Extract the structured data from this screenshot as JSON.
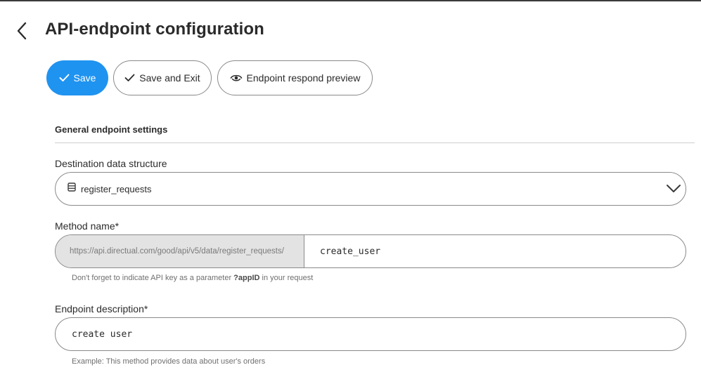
{
  "header": {
    "title": "API-endpoint configuration",
    "back_icon": "chevron-left-icon"
  },
  "toolbar": {
    "save_label": "Save",
    "save_exit_label": "Save and Exit",
    "preview_label": "Endpoint respond preview",
    "save_color": "#1f93f0"
  },
  "general": {
    "section_title": "General endpoint settings",
    "destination": {
      "label": "Destination data structure",
      "value": "register_requests",
      "icon": "database-icon"
    },
    "method": {
      "label": "Method name*",
      "prefix": "https://api.directual.com/good/api/v5/data/register_requests/",
      "value": "create_user",
      "hint_prefix": "Don't forget to indicate API key as a parameter ",
      "hint_param": "?appID",
      "hint_suffix": " in your request"
    },
    "description": {
      "label": "Endpoint description*",
      "value": "create user",
      "hint": "Example: This method provides data about user's orders"
    }
  }
}
